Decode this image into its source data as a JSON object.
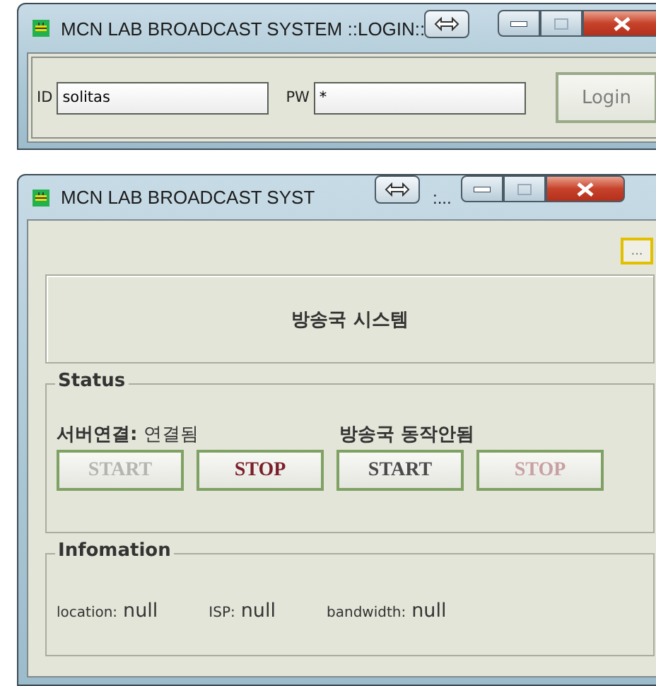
{
  "login_window": {
    "title": "MCN LAB BROADCAST SYSTEM ::LOGIN::",
    "id_label": "ID",
    "id_value": "solitas",
    "pw_label": "PW",
    "pw_value": "*",
    "login_button": {
      "label": "Login",
      "disabled": true
    }
  },
  "main_window": {
    "title": "MCN LAB BROADCAST SYST",
    "title_tail": ":...",
    "more_button": "...",
    "header": "방송국 시스템",
    "status": {
      "legend": "Status",
      "server_label": "**서버연결:** 연결됨",
      "station_label": "방송국 동작안됨",
      "buttons": [
        {
          "label": "START",
          "kind": "start",
          "disabled": true
        },
        {
          "label": "STOP",
          "kind": "stop",
          "disabled": false
        },
        {
          "label": "START",
          "kind": "start",
          "disabled": false
        },
        {
          "label": "STOP",
          "kind": "stop",
          "disabled": true
        }
      ]
    },
    "info": {
      "legend": "Infomation",
      "fields": [
        {
          "label": "location:",
          "value": "null"
        },
        {
          "label": "ISP:",
          "value": "null"
        },
        {
          "label": "bandwidth:",
          "value": "null"
        }
      ]
    }
  }
}
